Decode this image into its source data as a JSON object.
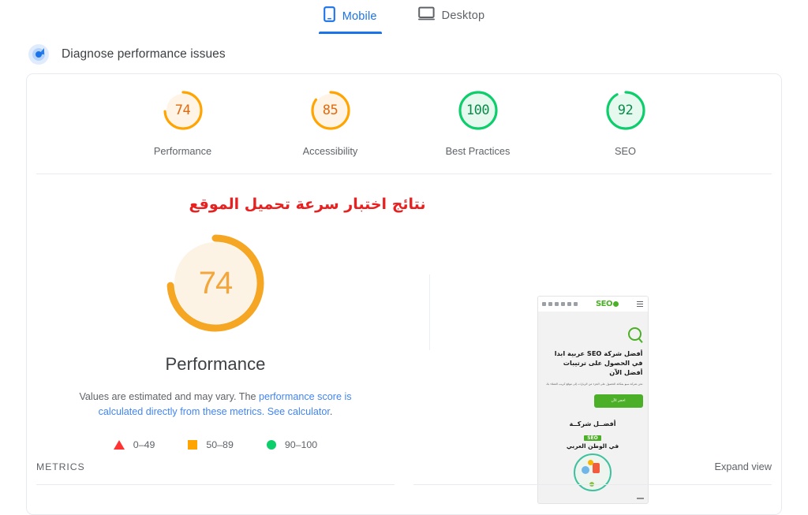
{
  "tabs": [
    {
      "label": "Mobile",
      "icon": "mobile-phone-icon",
      "active": true
    },
    {
      "label": "Desktop",
      "icon": "desktop-monitor-icon",
      "active": false
    }
  ],
  "diagnose": {
    "icon": "radar-pulse-icon",
    "label": "Diagnose performance issues"
  },
  "scores": [
    {
      "value": "74",
      "label": "Performance",
      "color": "#ffa400",
      "fill": "#fff4e5",
      "pct": 74
    },
    {
      "value": "85",
      "label": "Accessibility",
      "color": "#ffa400",
      "fill": "#fff4e5",
      "pct": 85
    },
    {
      "value": "100",
      "label": "Best Practices",
      "color": "#0cce6b",
      "fill": "#e6f9ef",
      "pct": 100
    },
    {
      "value": "92",
      "label": "SEO",
      "color": "#0cce6b",
      "fill": "#e6f9ef",
      "pct": 92
    }
  ],
  "arabic_heading": "نتائج اختبار سرعة تحميل الموقع",
  "main_gauge": {
    "value": "74",
    "title": "Performance",
    "color": "#f5a623",
    "fill": "#fdf3e4",
    "pct": 74
  },
  "description": {
    "text_before": "Values are estimated and may vary. The ",
    "link1": "performance score is calculated directly from these metrics.",
    "link2": "See calculator",
    "period": "."
  },
  "legend": [
    {
      "shape": "triangle",
      "range": "0–49",
      "color": "#ff3333"
    },
    {
      "shape": "square",
      "range": "50–89",
      "color": "#ffa400"
    },
    {
      "shape": "circle",
      "range": "90–100",
      "color": "#0cce6b"
    }
  ],
  "thumbnail": {
    "logo": "SEO",
    "headline": "أفضل شركة SEO عربية ابدا في الحصول على ترتيبات أفضل الآن",
    "subtext": "نحن شركة سيو بمكانة الحصول على الجزء من الزيارات إلى موقع كريب العملاء بك",
    "cta": "احجز الآن",
    "mid_line1": "أفضــل شركــة",
    "mid_badge": "SEO",
    "mid_line2": "في الوطن العربي"
  },
  "metrics": {
    "label": "METRICS",
    "expand": "Expand view"
  },
  "colors": {
    "accent_blue": "#1a73e8",
    "link_blue": "#4285f4",
    "orange": "#ffa400",
    "green": "#0cce6b",
    "red": "#ff3333",
    "arabic_red": "#e8201f"
  }
}
